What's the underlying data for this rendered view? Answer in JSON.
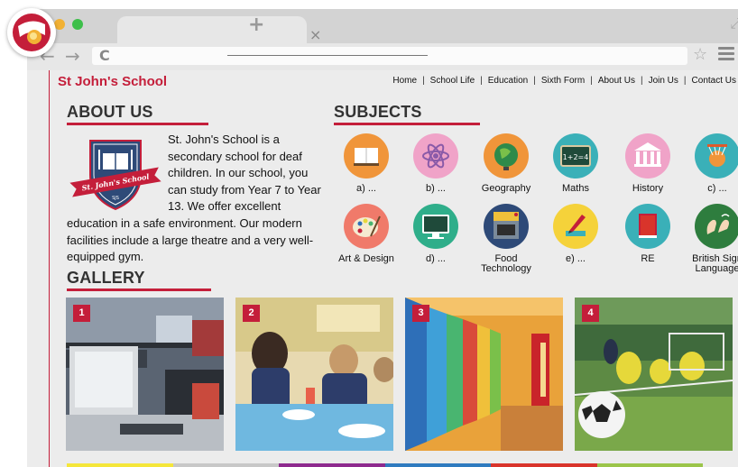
{
  "browser": {
    "tab_close": "×",
    "new_tab": "+",
    "back": "←",
    "forward": "→",
    "reload": "C",
    "star": "☆",
    "maximize": "⤢"
  },
  "site": {
    "title": "St John's School",
    "nav": [
      "Home",
      "School Life",
      "Education",
      "Sixth Form",
      "About Us",
      "Join Us",
      "Contact Us"
    ],
    "nav_separator": "|"
  },
  "about": {
    "heading": "ABOUT US",
    "text": "St. John's School is a secondary school for deaf children. In our school, you can study from Year 7 to Year 13. We offer excellent education in a safe environment. Our modern facilities include a large theatre and a very well-equipped gym.",
    "crest_banner": "St. John's School",
    "crest_initials": "SJS"
  },
  "subjects": {
    "heading": "SUBJECTS",
    "items": [
      {
        "label": "a) ...",
        "icon": "book-icon",
        "color": "#f0953a"
      },
      {
        "label": "b) ...",
        "icon": "atom-icon",
        "color": "#f0a3c8"
      },
      {
        "label": "Geography",
        "icon": "globe-icon",
        "color": "#f0953a"
      },
      {
        "label": "Maths",
        "icon": "calculator-icon",
        "color": "#3ab0b8"
      },
      {
        "label": "History",
        "icon": "temple-icon",
        "color": "#f0a3c8"
      },
      {
        "label": "c) ...",
        "icon": "basketball-icon",
        "color": "#3ab0b8"
      },
      {
        "label": "Art & Design",
        "icon": "palette-icon",
        "color": "#f07a6a"
      },
      {
        "label": "d) ...",
        "icon": "monitor-icon",
        "color": "#2fae8a"
      },
      {
        "label": "Food Technology",
        "icon": "oven-icon",
        "color": "#2e4a78"
      },
      {
        "label": "e) ...",
        "icon": "pencil-icon",
        "color": "#f5d23a"
      },
      {
        "label": "RE",
        "icon": "scripture-book-icon",
        "color": "#3ab0b8"
      },
      {
        "label": "British Sign Language",
        "icon": "sign-hands-icon",
        "color": "#2e7d3e"
      }
    ]
  },
  "gallery": {
    "heading": "GALLERY",
    "photos": [
      {
        "number": "1",
        "subject": "computer-room-photo"
      },
      {
        "number": "2",
        "subject": "dining-hall-photo"
      },
      {
        "number": "3",
        "subject": "lockers-corridor-photo"
      },
      {
        "number": "4",
        "subject": "football-field-photo"
      }
    ]
  },
  "accent_colors": {
    "brand_red": "#c41e3a",
    "footer_strip": [
      "#f5e63a",
      "#c8c8c8",
      "#8e2a8e",
      "#2f7bbf",
      "#d9342b",
      "#9bc54a"
    ]
  }
}
